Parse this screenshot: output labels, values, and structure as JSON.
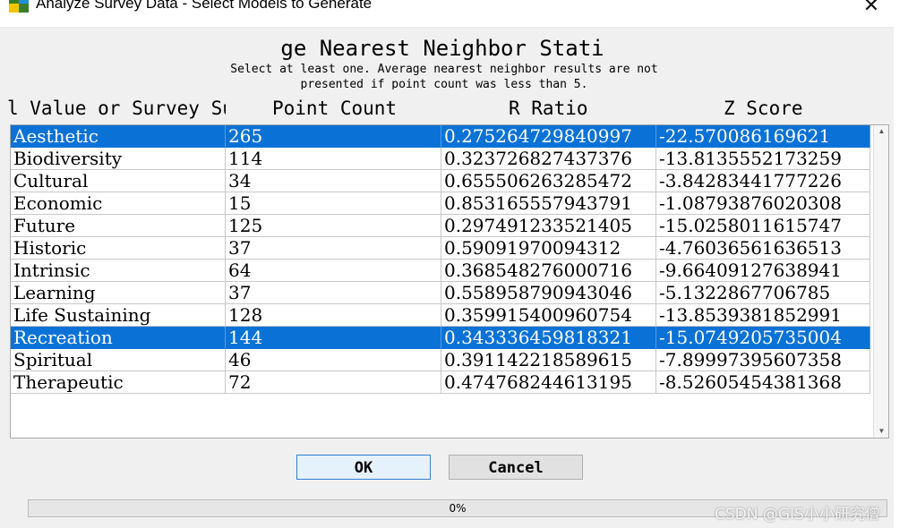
{
  "window": {
    "title": "Analyze Survey Data - Select Models to Generate",
    "close_glyph": "✕",
    "app_icon": "arcgis-app-icon"
  },
  "dialog": {
    "title": "ge Nearest Neighbor Stati",
    "instruction_line1": "Select at least one. Average nearest neighbor results are not",
    "instruction_line2": "presented if point count was less than 5."
  },
  "table": {
    "headers": [
      "l Value or Survey Sub",
      "Point Count",
      "R Ratio",
      "Z Score"
    ],
    "rows": [
      {
        "name": "Aesthetic",
        "count": "265",
        "r_ratio": "0.275264729840997",
        "z_score": "-22.570086169621",
        "selected": true
      },
      {
        "name": "Biodiversity",
        "count": "114",
        "r_ratio": "0.323726827437376",
        "z_score": "-13.8135552173259",
        "selected": false
      },
      {
        "name": "Cultural",
        "count": "34",
        "r_ratio": "0.655506263285472",
        "z_score": "-3.84283441777226",
        "selected": false
      },
      {
        "name": "Economic",
        "count": "15",
        "r_ratio": "0.853165557943791",
        "z_score": "-1.08793876020308",
        "selected": false
      },
      {
        "name": "Future",
        "count": "125",
        "r_ratio": "0.297491233521405",
        "z_score": "-15.0258011615747",
        "selected": false
      },
      {
        "name": "Historic",
        "count": "37",
        "r_ratio": "0.59091970094312",
        "z_score": "-4.76036561636513",
        "selected": false
      },
      {
        "name": "Intrinsic",
        "count": "64",
        "r_ratio": "0.368548276000716",
        "z_score": "-9.66409127638941",
        "selected": false
      },
      {
        "name": "Learning",
        "count": "37",
        "r_ratio": "0.558958790943046",
        "z_score": "-5.1322867706785",
        "selected": false
      },
      {
        "name": "Life Sustaining",
        "count": "128",
        "r_ratio": "0.359915400960754",
        "z_score": "-13.8539381852991",
        "selected": false
      },
      {
        "name": "Recreation",
        "count": "144",
        "r_ratio": "0.343336459818321",
        "z_score": "-15.0749205735004",
        "selected": true
      },
      {
        "name": "Spiritual",
        "count": "46",
        "r_ratio": "0.391142218589615",
        "z_score": "-7.89997395607358",
        "selected": false
      },
      {
        "name": "Therapeutic",
        "count": "72",
        "r_ratio": "0.474768244613195",
        "z_score": "-8.52605454381368",
        "selected": false
      }
    ]
  },
  "buttons": {
    "ok": "OK",
    "cancel": "Cancel"
  },
  "progress": {
    "value": 0,
    "text": "0%"
  },
  "watermark": "CSDN @GIS小小研究僧",
  "colors": {
    "selection": "#0a72d6",
    "progress_fill": "#06b025"
  }
}
